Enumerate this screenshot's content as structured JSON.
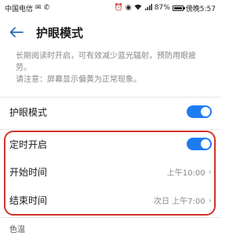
{
  "status": {
    "carrier": "中国电信",
    "battery": "87%",
    "battery_level": 0.87,
    "time": "傍晚5:57"
  },
  "header": {
    "title": "护眼模式",
    "back_icon": "arrow-left-icon"
  },
  "description": {
    "line1": "长期阅读时开启，可有效减少蓝光辐射，预防用眼疲劳。",
    "line2": "请注意：屏幕显示偏黄为正常现象。"
  },
  "settings": {
    "eye_mode": {
      "label": "护眼模式",
      "on": true
    },
    "schedule": {
      "label": "定时开启",
      "on": true
    },
    "start_time": {
      "label": "开始时间",
      "value": "上午10:00"
    },
    "end_time": {
      "label": "结束时间",
      "value": "次日 上午7:00"
    }
  },
  "section": {
    "color_temp_label": "色温"
  },
  "colors": {
    "accent": "#1d7cf2",
    "highlight_border": "#d0342c",
    "secondary_text": "#888888"
  }
}
